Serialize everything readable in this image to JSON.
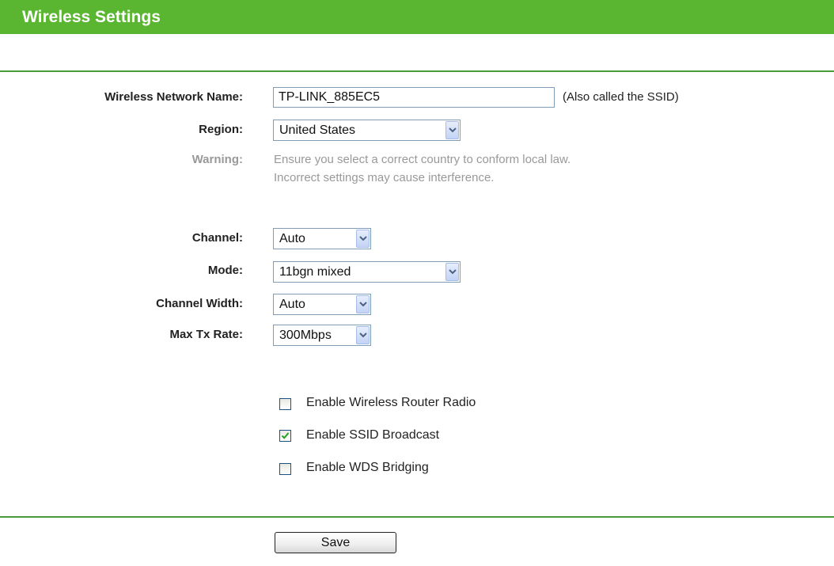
{
  "header": {
    "title": "Wireless Settings",
    "bar_color": "#5ab630"
  },
  "form": {
    "ssid": {
      "label": "Wireless Network Name:",
      "value": "TP-LINK_885EC5",
      "hint": "(Also called the SSID)"
    },
    "region": {
      "label": "Region:",
      "value": "United States"
    },
    "warning": {
      "label": "Warning:",
      "line1": "Ensure you select a correct country to conform local law.",
      "line2": "Incorrect settings may cause interference."
    },
    "channel": {
      "label": "Channel:",
      "value": "Auto"
    },
    "mode": {
      "label": "Mode:",
      "value": "11bgn mixed"
    },
    "channel_width": {
      "label": "Channel Width:",
      "value": "Auto"
    },
    "max_tx_rate": {
      "label": "Max Tx Rate:",
      "value": "300Mbps"
    }
  },
  "options": [
    {
      "label": "Enable Wireless Router Radio",
      "checked": false
    },
    {
      "label": "Enable SSID Broadcast",
      "checked": true
    },
    {
      "label": "Enable WDS Bridging",
      "checked": false
    }
  ],
  "actions": {
    "save_label": "Save"
  },
  "icons": {
    "dropdown": "chevron-down-icon",
    "checkmark": "checkmark-icon"
  }
}
